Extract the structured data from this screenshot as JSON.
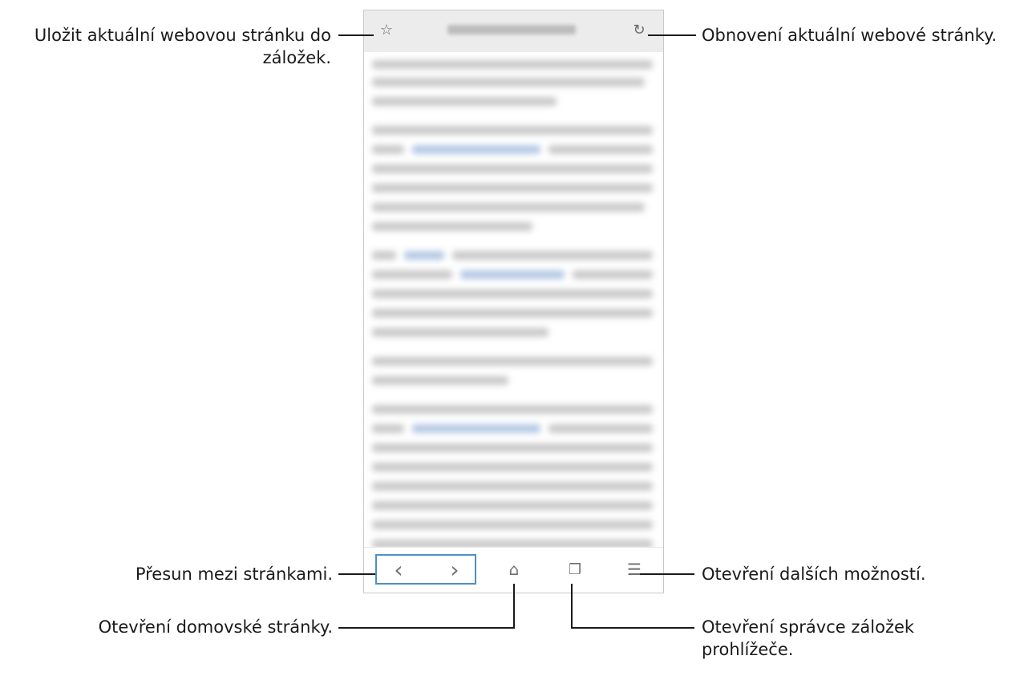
{
  "callouts": {
    "bookmark_line1": "Uložit aktuální webovou stránku do",
    "bookmark_line2": "záložek.",
    "refresh": "Obnovení aktuální webové stránky.",
    "navigate": "Přesun mezi stránkami.",
    "more_options": "Otevření dalších možností.",
    "home": "Otevření domovské stránky.",
    "tabs_line1": "Otevření správce záložek",
    "tabs_line2": "prohlížeče."
  },
  "icons": {
    "star": "☆",
    "refresh": "↻",
    "back": "‹",
    "forward": "›",
    "home": "⌂",
    "tabs": "❐",
    "menu": "☰"
  },
  "colors": {
    "highlight_box": "#4a90c8",
    "link_text": "#b3c8e4"
  }
}
